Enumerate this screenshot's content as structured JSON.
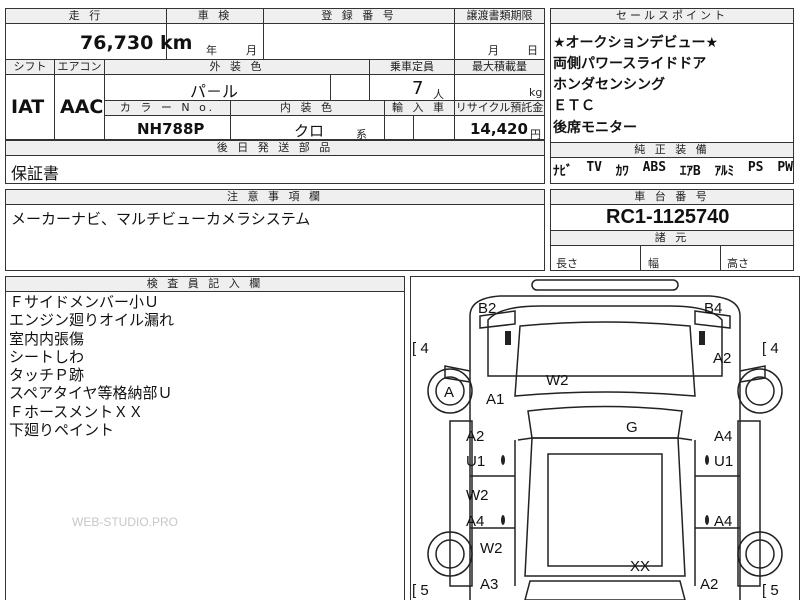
{
  "top_header": {
    "mileage_label": "走 行",
    "inspection_label": "車 検",
    "registration_label": "登 録 番 号",
    "transfer_label": "譲渡書類期限",
    "selling_points_label": "セールスポイント"
  },
  "mileage": {
    "value": "76,730",
    "unit": "km"
  },
  "inspection": {
    "year_unit": "年",
    "month_unit": "月"
  },
  "transfer": {
    "month_unit": "月",
    "day_unit": "日"
  },
  "row2": {
    "shift_label": "シフト",
    "aircon_label": "エアコン",
    "exterior_color_label": "外 装 色",
    "capacity_label": "乗車定員",
    "max_load_label": "最大積載量",
    "shift_value": "IAT",
    "aircon_value": "AAC",
    "exterior_color_value": "パ－ル",
    "capacity_value": "7",
    "capacity_unit": "人",
    "max_load_unit": "kg"
  },
  "row3": {
    "color_no_label": "カ ラ ー N o.",
    "interior_color_label": "内 装 色",
    "import_label": "輸 入 車",
    "recycle_label": "リサイクル預託金",
    "color_no_value": "NH788P",
    "interior_color_value": "クロ",
    "interior_color_suffix": "系",
    "recycle_value": "14,420",
    "recycle_unit": "円"
  },
  "later_parts": {
    "label": "後 日 発 送 部 品",
    "value": "保証書"
  },
  "selling_points": [
    "★オークションデビュー★",
    "両側パワースライドドア",
    "ホンダセンシング",
    "ＥＴＣ",
    "後席モニター"
  ],
  "standard_equipment": {
    "label": "純 正 装 備",
    "items": [
      "ﾅﾋﾞ",
      "TV",
      "ｶﾜ",
      "ABS",
      "ｴｱB",
      "ｱﾙﾐ",
      "PS",
      "PW"
    ]
  },
  "notes": {
    "label": "注 意 事 項 欄",
    "text": "メーカーナビ、マルチビューカメラシステム"
  },
  "chassis": {
    "label": "車 台 番 号",
    "value": "RC1-1125740"
  },
  "dimensions": {
    "label": "諸 元",
    "length_label": "長さ",
    "width_label": "幅",
    "height_label": "高さ"
  },
  "inspector": {
    "label": "検 査 員 記 入 欄",
    "lines": [
      "Ｆサイドメンバー小Ｕ",
      "エンジン廻りオイル漏れ",
      "室内内張傷",
      "シートしわ",
      "タッチＰ跡",
      "スペアタイヤ等格納部Ｕ",
      "ＦホースメントＸＸ",
      "下廻りペイント"
    ]
  },
  "diagram": {
    "codes": {
      "b2": "B2",
      "b4": "B4",
      "w2_roof": "W2",
      "a_left": "A",
      "a1": "A1",
      "a2_right_top": "A2",
      "g": "G",
      "a2_left": "A2",
      "u1_left": "U1",
      "a4_right": "A4",
      "u1_right": "U1",
      "w2_left": "W2",
      "a4_left": "A4",
      "a4_right2": "A4",
      "w2_left2": "W2",
      "xx": "XX",
      "a3": "A3",
      "a2_bottom": "A2"
    },
    "tread": {
      "top_left": "4",
      "top_right": "4",
      "bottom_left": "5",
      "bottom_right": "5"
    }
  },
  "watermark": "WEB-STUDIO.PRO"
}
